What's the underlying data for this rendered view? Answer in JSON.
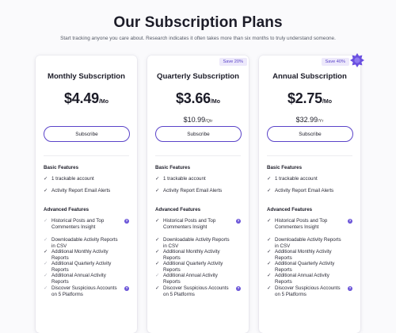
{
  "header": {
    "title": "Our Subscription Plans",
    "subtitle": "Start tracking anyone you care about. Research indicates it often takes more than six months to truly understand someone."
  },
  "colors": {
    "accent": "#5b44c9",
    "tag_background": "#ede9fb",
    "background": "#fafafc"
  },
  "sections": {
    "basic": "Basic Features",
    "advanced": "Advanced Features"
  },
  "plans": [
    {
      "title": "Monthly Subscription",
      "price": "$4.49",
      "price_unit": "/Mo",
      "sub_price": "",
      "sub_unit": "",
      "save_tag": "",
      "button": "Subscribe"
    },
    {
      "title": "Quarterly Subscription",
      "price": "$3.66",
      "price_unit": "/Mo",
      "sub_price": "$10.99",
      "sub_unit": "/Qtr",
      "save_tag": "Save 20%",
      "button": "Subscribe"
    },
    {
      "title": "Annual Subscription",
      "price": "$2.75",
      "price_unit": "/Mo",
      "sub_price": "$32.99",
      "sub_unit": "/Yr",
      "save_tag": "Save 40%",
      "button": "Subscribe",
      "badge_icon": "star-badge-icon"
    }
  ],
  "basic_features": [
    {
      "label": "1 trackable account"
    },
    {
      "label": "Activity Report Email Alerts"
    }
  ],
  "advanced_features": [
    {
      "label": "Historical Posts and Top Commenters Insight",
      "info": "?"
    },
    {
      "label": "Downloadable Activity Reports in CSV"
    },
    {
      "label": "Additional Monthly Activity Reports"
    },
    {
      "label": "Additional Quarterly Activity Reports"
    },
    {
      "label": "Additional Annual Activity Reports"
    },
    {
      "label": "Discover Suspicious Accounts on 5 Platforms",
      "info": "?"
    }
  ],
  "plan_feature_status": [
    {
      "basic": [
        true,
        true
      ],
      "advanced": [
        false,
        false,
        true,
        false,
        false,
        false
      ]
    },
    {
      "basic": [
        true,
        true
      ],
      "advanced": [
        true,
        true,
        true,
        true,
        false,
        true
      ]
    },
    {
      "basic": [
        true,
        true
      ],
      "advanced": [
        true,
        true,
        true,
        true,
        true,
        true
      ]
    }
  ],
  "icons": {
    "check": "check-icon",
    "info": "info-icon"
  }
}
